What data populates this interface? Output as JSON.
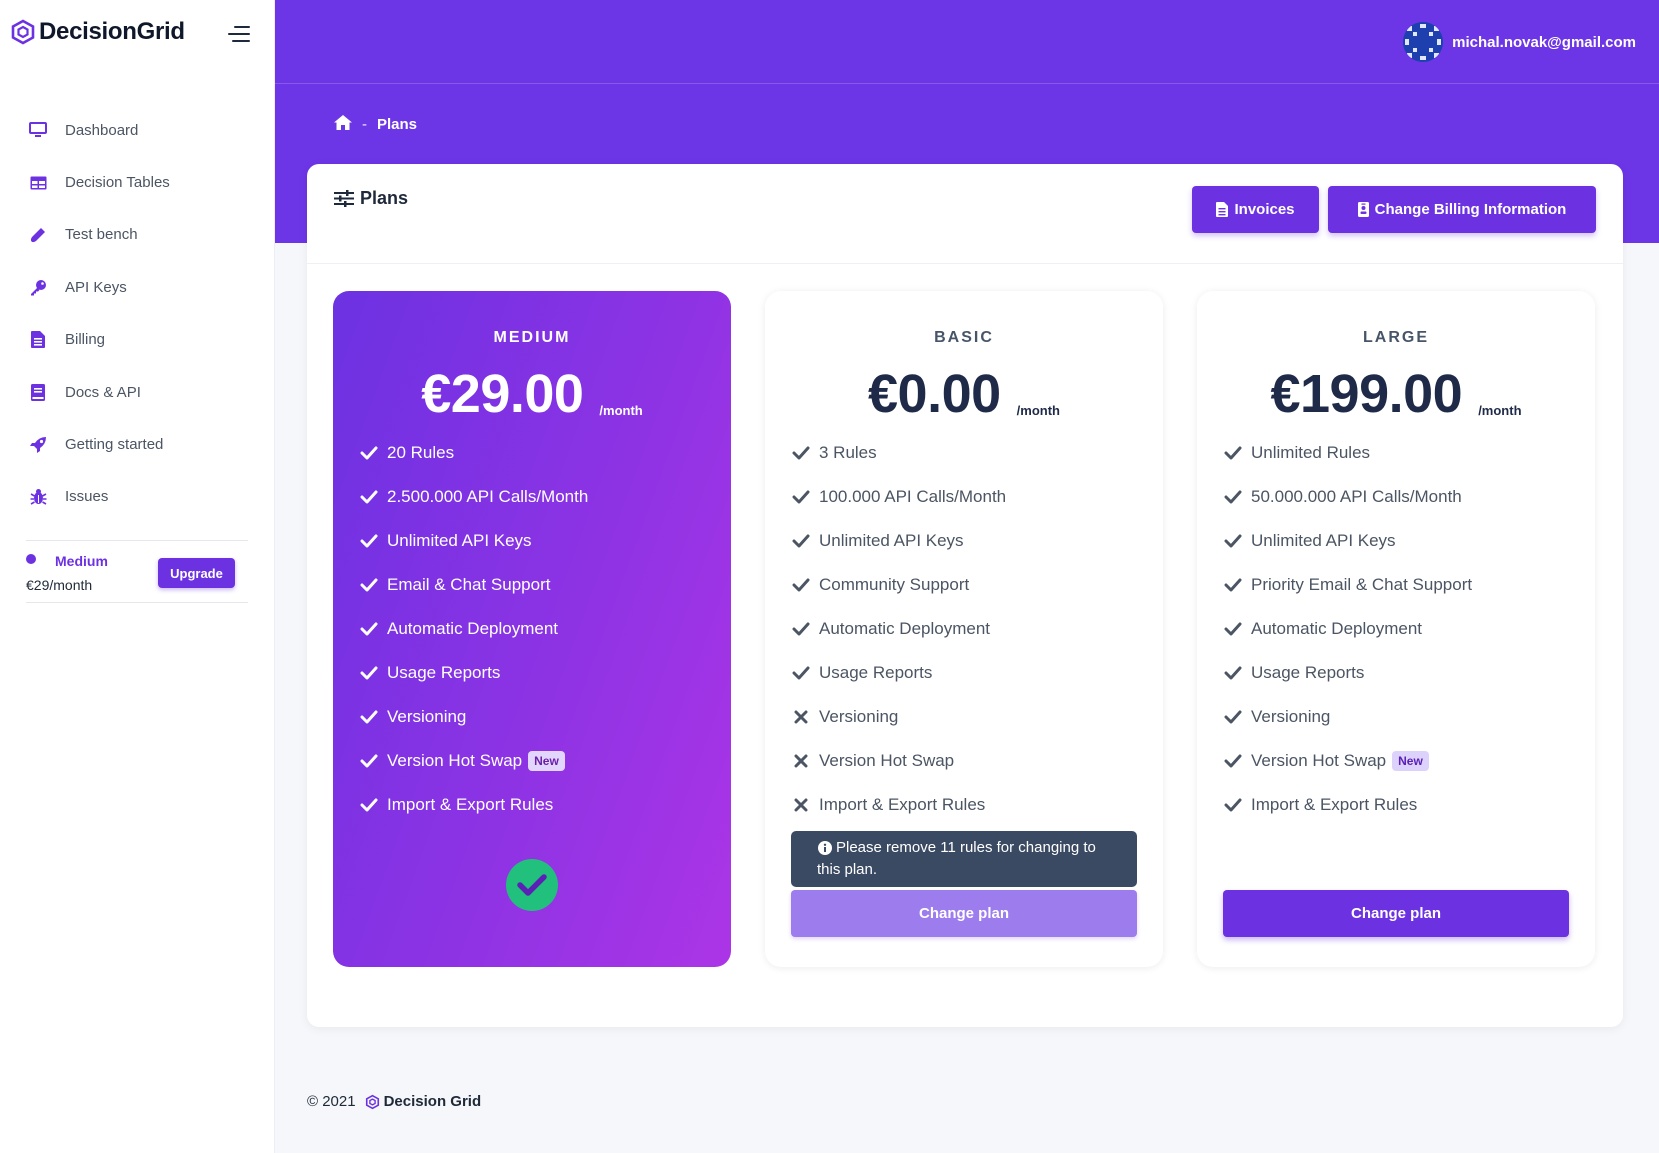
{
  "brand": {
    "name": "DecisionGrid"
  },
  "sidebar": {
    "items": [
      {
        "label": "Dashboard",
        "icon": "monitor-icon"
      },
      {
        "label": "Decision Tables",
        "icon": "table-icon"
      },
      {
        "label": "Test bench",
        "icon": "flask-icon"
      },
      {
        "label": "API Keys",
        "icon": "key-icon"
      },
      {
        "label": "Billing",
        "icon": "document-icon"
      },
      {
        "label": "Docs & API",
        "icon": "book-icon"
      },
      {
        "label": "Getting started",
        "icon": "rocket-icon"
      },
      {
        "label": "Issues",
        "icon": "bug-icon"
      }
    ],
    "current_plan": {
      "name": "Medium",
      "price": "€29/month",
      "upgrade_label": "Upgrade"
    }
  },
  "header": {
    "user_email": "michal.novak@gmail.com"
  },
  "breadcrumb": {
    "separator": "-",
    "current": "Plans"
  },
  "plans_card": {
    "title": "Plans",
    "invoices_label": "Invoices",
    "billing_label": "Change Billing Information"
  },
  "plans": [
    {
      "name": "MEDIUM",
      "price": "€29.00",
      "period": "/month",
      "current": true,
      "features": [
        {
          "label": "20 Rules",
          "included": true
        },
        {
          "label": "2.500.000 API Calls/Month",
          "included": true
        },
        {
          "label": "Unlimited API Keys",
          "included": true
        },
        {
          "label": "Email & Chat Support",
          "included": true
        },
        {
          "label": "Automatic Deployment",
          "included": true
        },
        {
          "label": "Usage Reports",
          "included": true
        },
        {
          "label": "Versioning",
          "included": true
        },
        {
          "label": "Version Hot Swap",
          "included": true,
          "badge": "New"
        },
        {
          "label": "Import & Export Rules",
          "included": true
        }
      ]
    },
    {
      "name": "BASIC",
      "price": "€0.00",
      "period": "/month",
      "current": false,
      "notice": "Please remove 11 rules for changing to this plan.",
      "button_label": "Change plan",
      "features": [
        {
          "label": "3 Rules",
          "included": true
        },
        {
          "label": "100.000 API Calls/Month",
          "included": true
        },
        {
          "label": "Unlimited API Keys",
          "included": true
        },
        {
          "label": "Community Support",
          "included": true
        },
        {
          "label": "Automatic Deployment",
          "included": true
        },
        {
          "label": "Usage Reports",
          "included": true
        },
        {
          "label": "Versioning",
          "included": false
        },
        {
          "label": "Version Hot Swap",
          "included": false
        },
        {
          "label": "Import & Export Rules",
          "included": false
        }
      ]
    },
    {
      "name": "LARGE",
      "price": "€199.00",
      "period": "/month",
      "current": false,
      "button_label": "Change plan",
      "features": [
        {
          "label": "Unlimited Rules",
          "included": true
        },
        {
          "label": "50.000.000 API Calls/Month",
          "included": true
        },
        {
          "label": "Unlimited API Keys",
          "included": true
        },
        {
          "label": "Priority Email & Chat Support",
          "included": true
        },
        {
          "label": "Automatic Deployment",
          "included": true
        },
        {
          "label": "Usage Reports",
          "included": true
        },
        {
          "label": "Versioning",
          "included": true
        },
        {
          "label": "Version Hot Swap",
          "included": true,
          "badge": "New"
        },
        {
          "label": "Import & Export Rules",
          "included": true
        }
      ]
    }
  ],
  "footer": {
    "copyright": "© 2021",
    "brand": "Decision Grid"
  },
  "colors": {
    "accent": "#6c32e2",
    "header": "#6c35e6",
    "success": "#22c07d",
    "notice": "#3b4a63"
  }
}
